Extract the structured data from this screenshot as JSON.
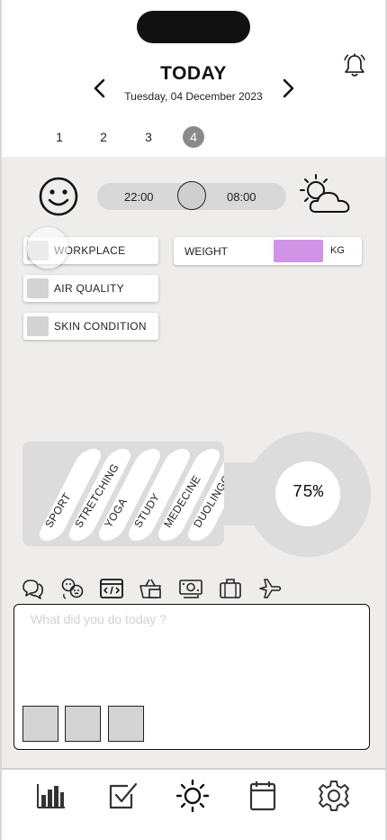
{
  "header": {
    "title": "TODAY",
    "date": "Tuesday, 04 December 2023",
    "prev_icon": "chevron-left-icon",
    "next_icon": "chevron-right-icon",
    "bell_icon": "bell-icon"
  },
  "days": [
    {
      "label": "1",
      "active": false
    },
    {
      "label": "2",
      "active": false
    },
    {
      "label": "3",
      "active": false
    },
    {
      "label": "4",
      "active": true
    }
  ],
  "sleep": {
    "mood_icon": "smiley-icon",
    "bedtime": "22:00",
    "waketime": "08:00",
    "weather_icon": "sun-cloud-icon"
  },
  "factors": [
    {
      "label": "WORKPLACE"
    },
    {
      "label": "AIR QUALITY"
    },
    {
      "label": "SKIN CONDITION"
    }
  ],
  "weight": {
    "label": "WEIGHT",
    "value": "",
    "unit": "KG",
    "accent": "#cf94e6"
  },
  "activities": [
    "SPORT",
    "STRETCHING",
    "YOGA",
    "STUDY",
    "MEDECINE",
    "DUOLINGO"
  ],
  "progress": {
    "label": "75%",
    "value": 75
  },
  "categories": [
    "chat-icon",
    "mood-faces-icon",
    "code-icon",
    "shopping-basket-icon",
    "money-icon",
    "briefcase-icon",
    "airplane-icon"
  ],
  "note": {
    "placeholder": "What did you do today ?",
    "value": ""
  },
  "tabs": [
    {
      "icon": "bar-chart-icon",
      "active": false
    },
    {
      "icon": "checkbox-icon",
      "active": false
    },
    {
      "icon": "sun-icon",
      "active": true
    },
    {
      "icon": "calendar-icon",
      "active": false
    },
    {
      "icon": "settings-gear-icon",
      "active": false
    }
  ]
}
